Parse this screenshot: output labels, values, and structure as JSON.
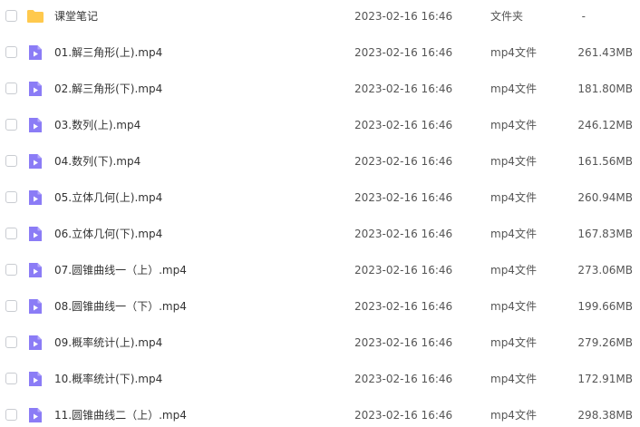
{
  "colors": {
    "folder_icon": "#ffc94d",
    "video_icon": "#8b7cf6",
    "video_icon_fold": "#b5a9fb",
    "checkbox_border": "#c9ccd1"
  },
  "icons": {
    "folder": "folder-icon",
    "video": "video-file-icon"
  },
  "rows": [
    {
      "kind": "folder",
      "name": "课堂笔记",
      "date": "2023-02-16 16:46",
      "type": "文件夹",
      "size": "-"
    },
    {
      "kind": "video",
      "name": "01.解三角形(上).mp4",
      "date": "2023-02-16 16:46",
      "type": "mp4文件",
      "size": "261.43MB"
    },
    {
      "kind": "video",
      "name": "02.解三角形(下).mp4",
      "date": "2023-02-16 16:46",
      "type": "mp4文件",
      "size": "181.80MB"
    },
    {
      "kind": "video",
      "name": "03.数列(上).mp4",
      "date": "2023-02-16 16:46",
      "type": "mp4文件",
      "size": "246.12MB"
    },
    {
      "kind": "video",
      "name": "04.数列(下).mp4",
      "date": "2023-02-16 16:46",
      "type": "mp4文件",
      "size": "161.56MB"
    },
    {
      "kind": "video",
      "name": "05.立体几何(上).mp4",
      "date": "2023-02-16 16:46",
      "type": "mp4文件",
      "size": "260.94MB"
    },
    {
      "kind": "video",
      "name": "06.立体几何(下).mp4",
      "date": "2023-02-16 16:46",
      "type": "mp4文件",
      "size": "167.83MB"
    },
    {
      "kind": "video",
      "name": "07.圆锥曲线一（上）.mp4",
      "date": "2023-02-16 16:46",
      "type": "mp4文件",
      "size": "273.06MB"
    },
    {
      "kind": "video",
      "name": "08.圆锥曲线一（下）.mp4",
      "date": "2023-02-16 16:46",
      "type": "mp4文件",
      "size": "199.66MB"
    },
    {
      "kind": "video",
      "name": "09.概率统计(上).mp4",
      "date": "2023-02-16 16:46",
      "type": "mp4文件",
      "size": "279.26MB"
    },
    {
      "kind": "video",
      "name": "10.概率统计(下).mp4",
      "date": "2023-02-16 16:46",
      "type": "mp4文件",
      "size": "172.91MB"
    },
    {
      "kind": "video",
      "name": "11.圆锥曲线二（上）.mp4",
      "date": "2023-02-16 16:46",
      "type": "mp4文件",
      "size": "298.38MB"
    }
  ]
}
